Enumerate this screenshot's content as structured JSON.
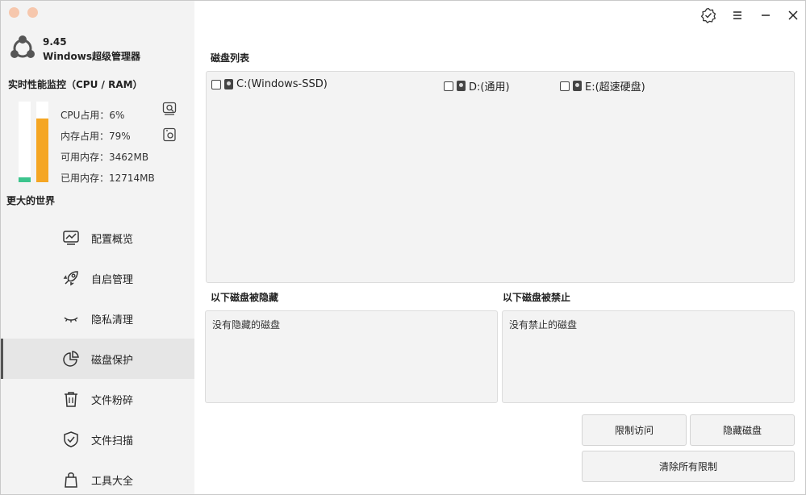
{
  "app": {
    "version": "9.45",
    "name": "Windows超级管理器"
  },
  "monitor": {
    "title": "实时性能监控（CPU / RAM）",
    "cpu_label": "CPU占用：6%",
    "mem_label": "内存占用：79%",
    "avail_label": "可用内存：3462MB",
    "used_label": "已用内存：12714MB",
    "cpu_percent": 6,
    "mem_percent": 79,
    "cpu_color": "#3cc48d",
    "mem_color": "#f5a623"
  },
  "sidebar": {
    "group_title": "更大的世界",
    "items": [
      {
        "label": "配置概览",
        "icon": "chart-monitor-icon"
      },
      {
        "label": "自启管理",
        "icon": "rocket-icon"
      },
      {
        "label": "隐私清理",
        "icon": "closed-eye-icon"
      },
      {
        "label": "磁盘保护",
        "icon": "pie-chart-icon"
      },
      {
        "label": "文件粉碎",
        "icon": "trash-icon"
      },
      {
        "label": "文件扫描",
        "icon": "shield-check-icon"
      },
      {
        "label": "工具大全",
        "icon": "bag-icon"
      }
    ],
    "active_index": 3
  },
  "main": {
    "disk_list_title": "磁盘列表",
    "disks": [
      {
        "label": "C:(Windows-SSD)",
        "checked": false
      },
      {
        "label": "D:(通用)",
        "checked": false
      },
      {
        "label": "E:(超速硬盘)",
        "checked": false
      }
    ],
    "hidden_title": "以下磁盘被隐藏",
    "hidden_empty": "没有隐藏的磁盘",
    "forbidden_title": "以下磁盘被禁止",
    "forbidden_empty": "没有禁止的磁盘",
    "buttons": {
      "restrict": "限制访问",
      "hide": "隐藏磁盘",
      "clear": "清除所有限制"
    }
  }
}
